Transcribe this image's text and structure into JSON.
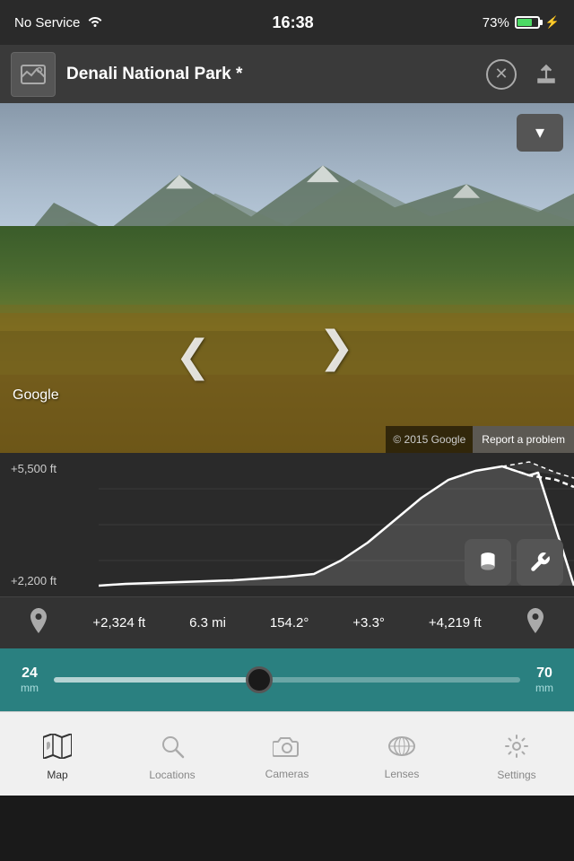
{
  "statusBar": {
    "signal": "No Service",
    "wifi": "wifi",
    "time": "16:38",
    "battery_pct": "73%",
    "bolt": "⚡"
  },
  "header": {
    "title": "Denali National Park *",
    "close_label": "✕",
    "share_label": "share"
  },
  "streetView": {
    "collapse_label": "▾",
    "arrow_left": "❮",
    "arrow_right": "❯",
    "watermark": "Google",
    "copyright": "© 2015 Google",
    "report": "Report a problem"
  },
  "elevation": {
    "label_top": "+5,500 ft",
    "label_bottom": "+2,200 ft",
    "btn_cylinder": "cylinder",
    "btn_wrench": "wrench"
  },
  "metrics": {
    "elevation": "+2,324 ft",
    "distance": "6.3 mi",
    "bearing": "154.2°",
    "slope": "+3.3°",
    "peak": "+4,219 ft"
  },
  "slider": {
    "min_value": "24",
    "min_unit": "mm",
    "max_value": "70",
    "max_unit": "mm"
  },
  "tabs": [
    {
      "id": "map",
      "label": "Map",
      "icon": "🗺",
      "active": true
    },
    {
      "id": "locations",
      "label": "Locations",
      "icon": "🔍",
      "active": false
    },
    {
      "id": "cameras",
      "label": "Cameras",
      "icon": "📷",
      "active": false
    },
    {
      "id": "lenses",
      "label": "Lenses",
      "icon": "🎞",
      "active": false
    },
    {
      "id": "settings",
      "label": "Settings",
      "icon": "⚙",
      "active": false
    }
  ]
}
